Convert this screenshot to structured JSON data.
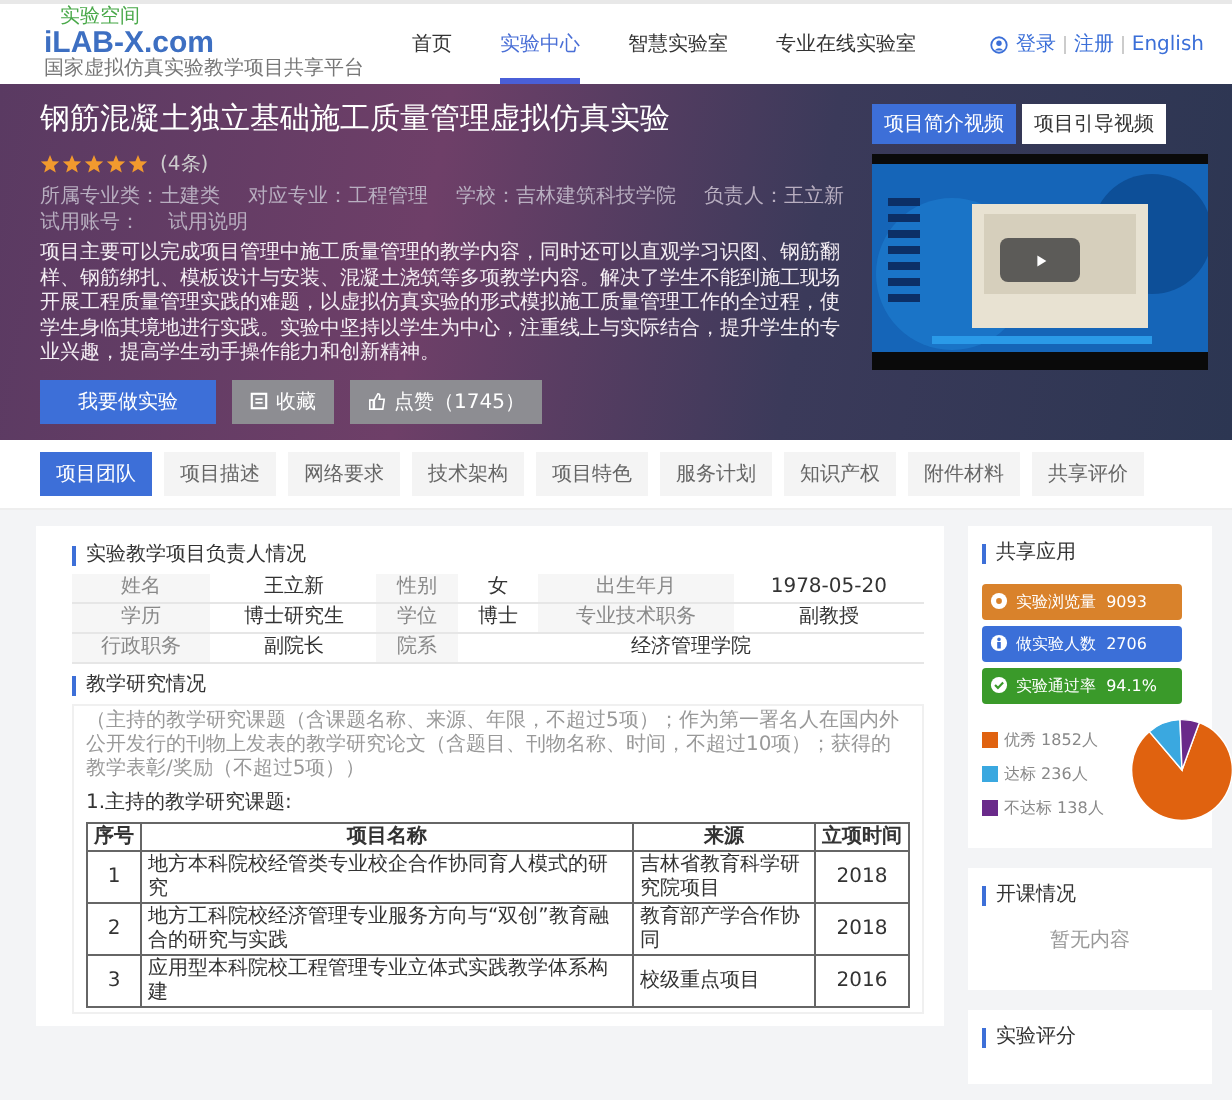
{
  "header": {
    "logo_mark": "实验空间",
    "logo": "iLAB-X.com",
    "logo_subtitle": "国家虚拟仿真实验教学项目共享平台",
    "nav": [
      {
        "label": "首页",
        "selected": false
      },
      {
        "label": "实验中心",
        "selected": true
      },
      {
        "label": "智慧实验室",
        "selected": false
      },
      {
        "label": "专业在线实验室",
        "selected": false
      }
    ],
    "account_links": [
      "登录",
      "注册",
      "English"
    ]
  },
  "hero": {
    "title": "钢筋混凝土独立基础施工质量管理虚拟仿真实验",
    "stars": 5,
    "rating_count": "(4条)",
    "meta": [
      "所属专业类：土建类",
      "对应专业：工程管理",
      "学校：吉林建筑科技学院",
      "负责人：王立新",
      "试用账号：",
      "试用说明"
    ],
    "description": "项目主要可以完成项目管理中施工质量管理的教学内容，同时还可以直观学习识图、钢筋翻样、钢筋绑扎、模板设计与安装、混凝土浇筑等多项教学内容。解决了学生不能到施工现场开展工程质量管理实践的难题，以虚拟仿真实验的形式模拟施工质量管理工作的全过程，使学生身临其境地进行实践。实验中坚持以学生为中心，注重线上与实际结合，提升学生的专业兴趣，提高学生动手操作能力和创新精神。",
    "buttons": [
      {
        "kind": "primary",
        "label": "我要做实验"
      },
      {
        "kind": "favorite",
        "label": "收藏"
      },
      {
        "kind": "like",
        "label": "点赞（1745）"
      }
    ],
    "video_tabs": [
      {
        "label": "项目简介视频",
        "selected": true
      },
      {
        "label": "项目引导视频",
        "selected": false
      }
    ]
  },
  "tabs": [
    {
      "label": "项目团队",
      "selected": true
    },
    {
      "label": "项目描述",
      "selected": false
    },
    {
      "label": "网络要求",
      "selected": false
    },
    {
      "label": "技术架构",
      "selected": false
    },
    {
      "label": "项目特色",
      "selected": false
    },
    {
      "label": "服务计划",
      "selected": false
    },
    {
      "label": "知识产权",
      "selected": false
    },
    {
      "label": "附件材料",
      "selected": false
    },
    {
      "label": "共享评价",
      "selected": false
    }
  ],
  "leader_section": {
    "title": "实验教学项目负责人情况",
    "rows": [
      [
        {
          "label": "姓名",
          "value": "王立新"
        },
        {
          "label": "性别",
          "value": "女"
        },
        {
          "label": "出生年月",
          "value": "1978-05-20"
        }
      ],
      [
        {
          "label": "学历",
          "value": "博士研究生"
        },
        {
          "label": "学位",
          "value": "博士"
        },
        {
          "label": "专业技术职务",
          "value": "副教授"
        }
      ],
      [
        {
          "label": "行政职务",
          "value": "副院长"
        },
        {
          "label": "院系",
          "value": "经济管理学院"
        }
      ]
    ]
  },
  "research_section": {
    "title": "教学研究情况",
    "note": "（主持的教学研究课题（含课题名称、来源、年限，不超过5项）；作为第一署名人在国内外公开发行的刊物上发表的教学研究论文（含题目、刊物名称、时间，不超过10项）；获得的教学表彰/奖励（不超过5项））",
    "subtitle": "1.主持的教学研究课题:",
    "columns": [
      "序号",
      "项目名称",
      "来源",
      "立项时间"
    ],
    "rows": [
      [
        "1",
        "地方本科院校经管类专业校企合作协同育人模式的研究",
        "吉林省教育科学研究院项目",
        "2018"
      ],
      [
        "2",
        "地方工科院校经济管理专业服务方向与“双创”教育融合的研究与实践",
        "教育部产学合作协同",
        "2018"
      ],
      [
        "3",
        "应用型本科院校工程管理专业立体式实践教学体系构建",
        "校级重点项目",
        "2016"
      ]
    ]
  },
  "share_card": {
    "title": "共享应用",
    "stats": [
      {
        "kind": "views",
        "color": "#d9822b",
        "label": "实验浏览量",
        "value": "9093"
      },
      {
        "kind": "people",
        "color": "#3b6fd8",
        "label": "做实验人数",
        "value": "2706"
      },
      {
        "kind": "pass",
        "color": "#3a9a2a",
        "label": "实验通过率",
        "value": "94.1%"
      }
    ],
    "legend": [
      {
        "value": "1852人",
        "color": "#e0620f"
      },
      {
        "value": "236人",
        "color": "#3aa8e0"
      },
      {
        "value": "138人",
        "color": "#6a2a8a"
      }
    ],
    "chart_data": {
      "type": "pie",
      "categories": [
        "优秀",
        "达标",
        "不达标"
      ],
      "values": [
        83.2,
        10.6,
        6.2
      ]
    }
  },
  "course_card": {
    "title": "开课情况",
    "empty_text": "暂无内容"
  },
  "rating_card": {
    "title": "实验评分"
  }
}
